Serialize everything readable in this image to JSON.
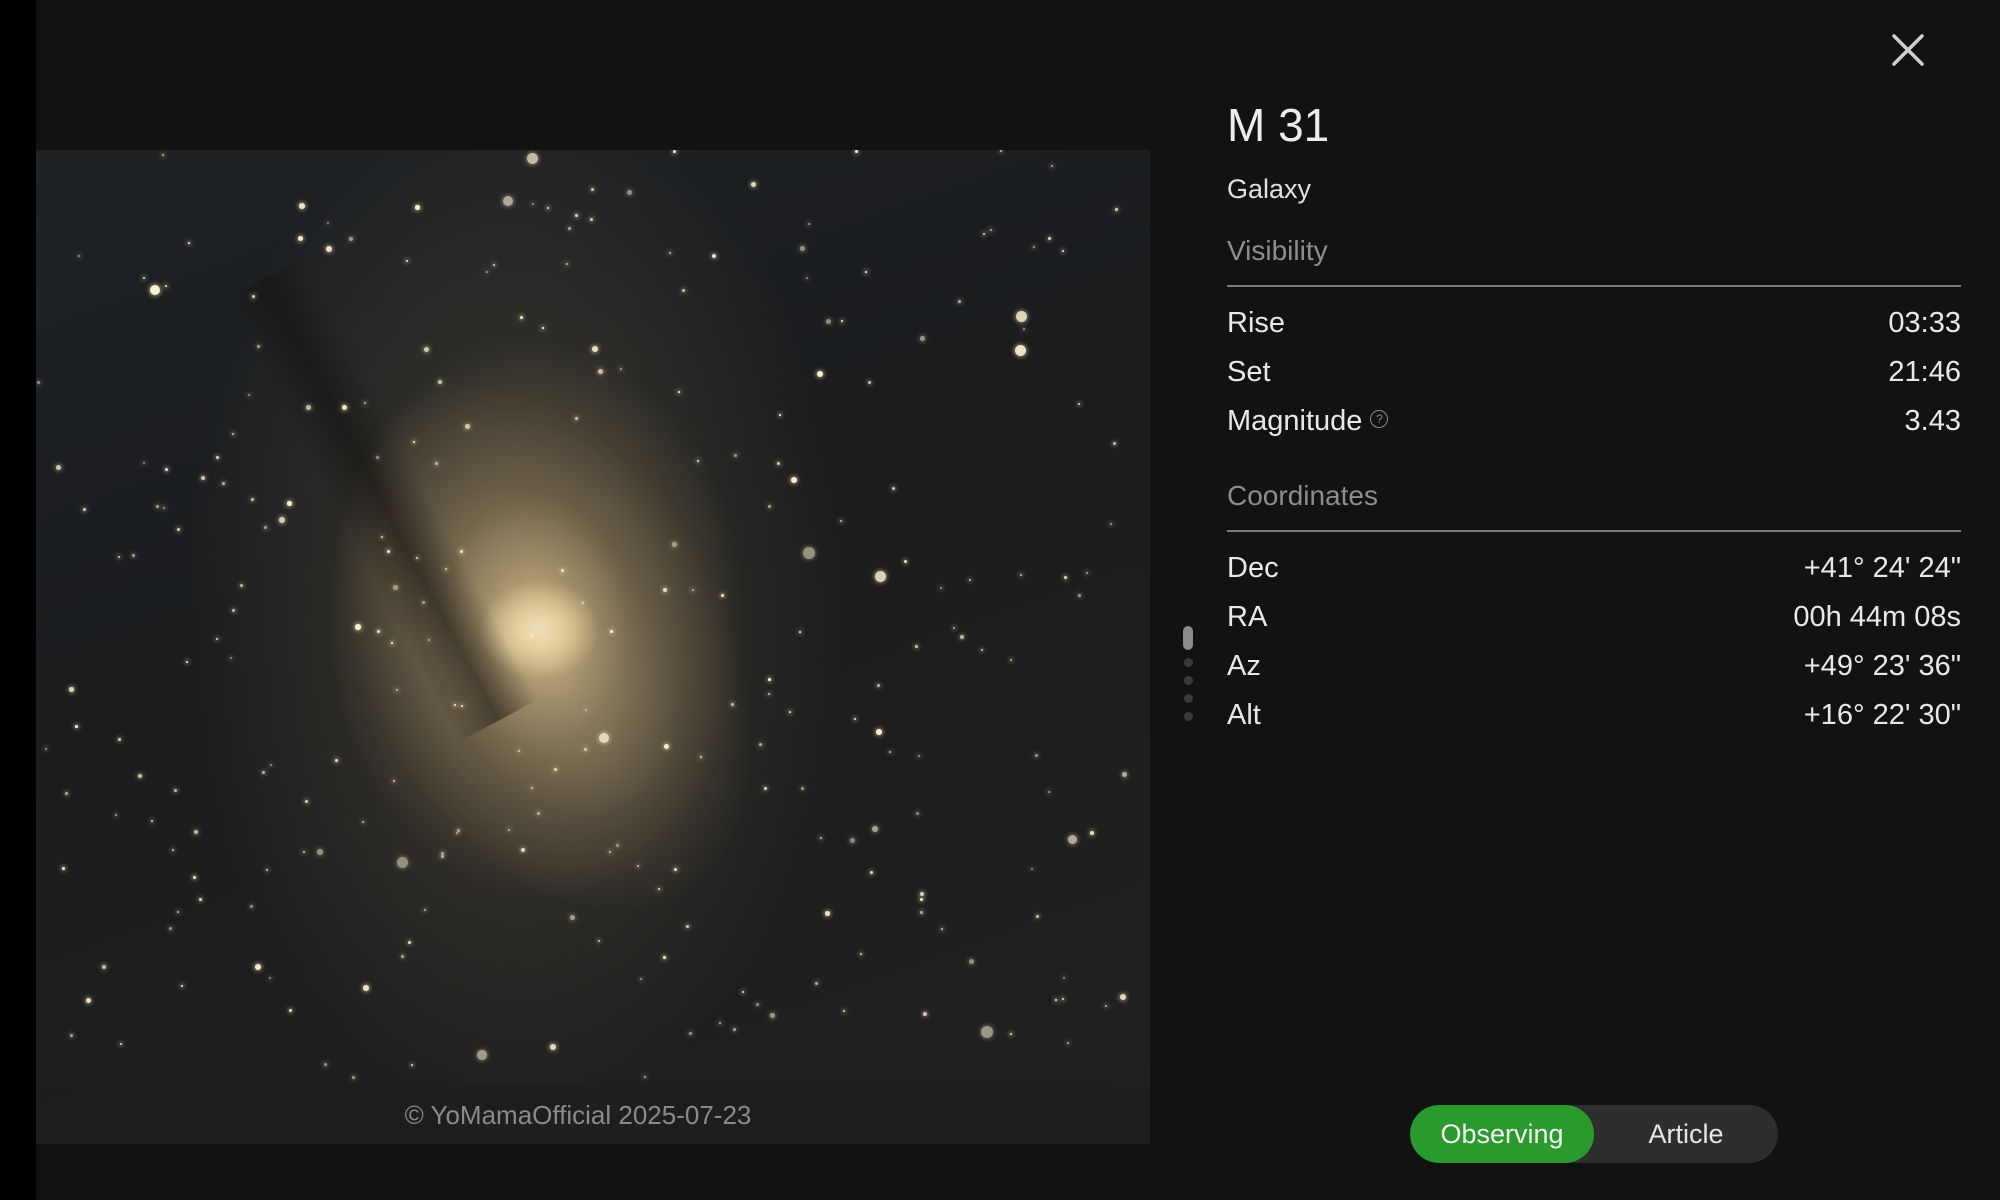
{
  "object": {
    "name": "M 31",
    "type": "Galaxy"
  },
  "photo": {
    "credit": "© YoMamaOfficial 2025-07-23"
  },
  "visibility": {
    "heading": "Visibility",
    "rise_label": "Rise",
    "rise_value": "03:33",
    "set_label": "Set",
    "set_value": "21:46",
    "magnitude_label": "Magnitude",
    "magnitude_value": "3.43",
    "magnitude_info_glyph": "?"
  },
  "coordinates": {
    "heading": "Coordinates",
    "rows": [
      {
        "label": "Dec",
        "value": "+41° 24' 24\""
      },
      {
        "label": "RA",
        "value": "00h 44m 08s"
      },
      {
        "label": "Az",
        "value": "+49° 23' 36\""
      },
      {
        "label": "Alt",
        "value": "+16° 22' 30\""
      }
    ]
  },
  "tabs": {
    "observing": "Observing",
    "article": "Article",
    "active": "observing"
  },
  "colors": {
    "accent": "#2a9a2e",
    "background": "#121212"
  },
  "icons": {
    "close": "close-icon",
    "info": "info-icon"
  }
}
